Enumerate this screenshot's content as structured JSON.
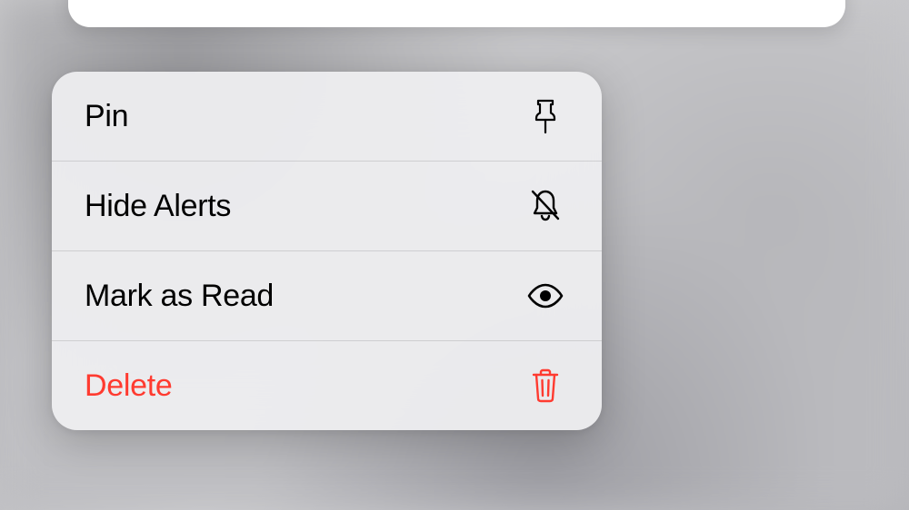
{
  "contextMenu": {
    "items": [
      {
        "label": "Pin",
        "icon": "pin-icon",
        "destructive": false
      },
      {
        "label": "Hide Alerts",
        "icon": "bell-slash-icon",
        "destructive": false
      },
      {
        "label": "Mark as Read",
        "icon": "eye-icon",
        "destructive": false
      },
      {
        "label": "Delete",
        "icon": "trash-icon",
        "destructive": true
      }
    ]
  },
  "colors": {
    "destructive": "#ff3b30",
    "text": "#000000",
    "menuBackground": "rgba(238,238,240,0.94)"
  }
}
